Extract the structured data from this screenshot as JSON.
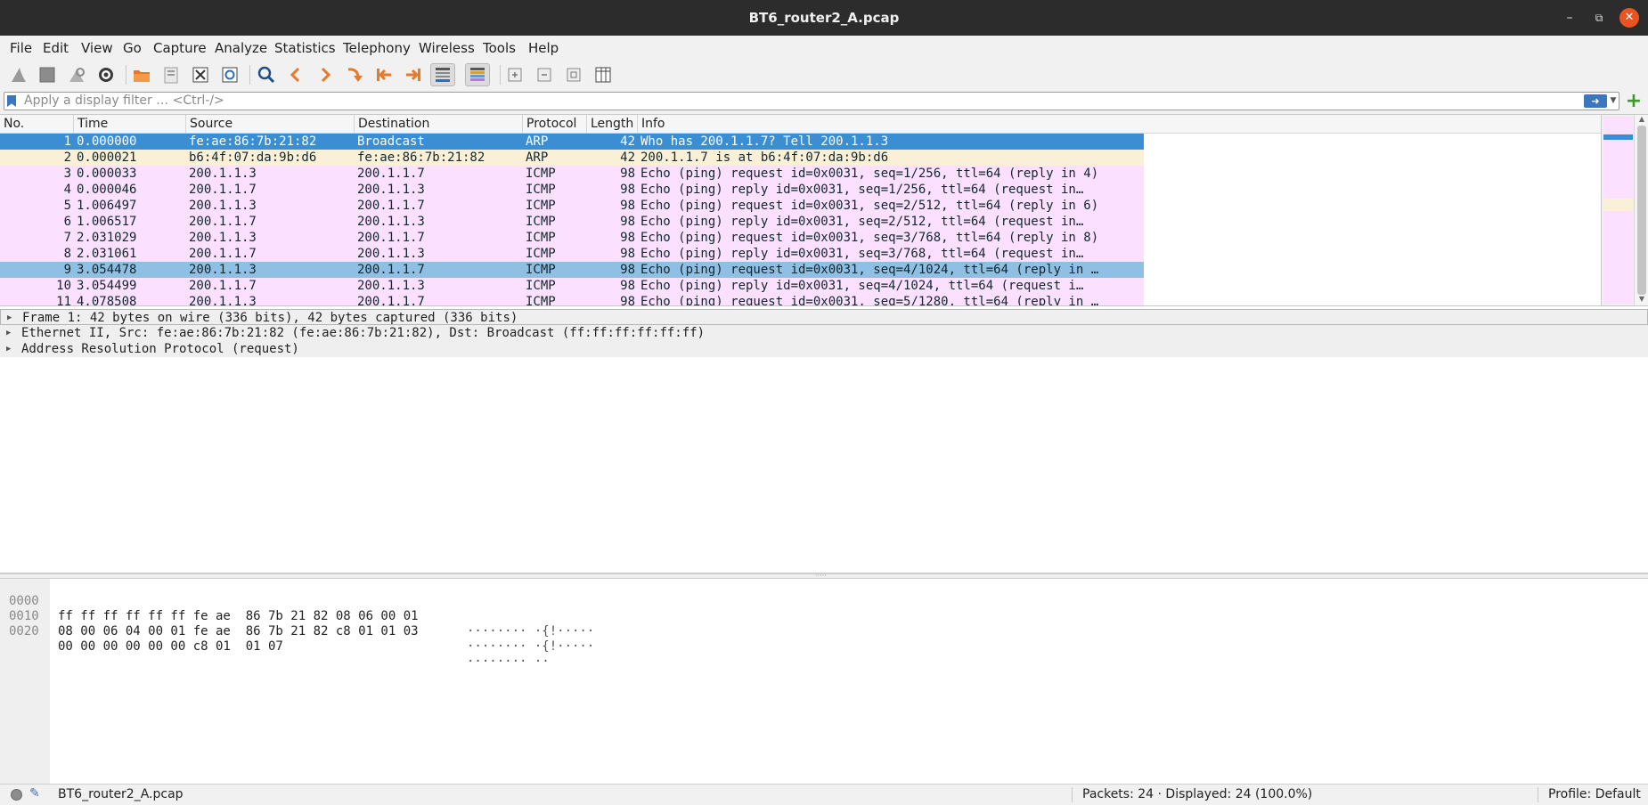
{
  "window": {
    "title": "BT6_router2_A.pcap"
  },
  "menu": [
    "File",
    "Edit",
    "View",
    "Go",
    "Capture",
    "Analyze",
    "Statistics",
    "Telephony",
    "Wireless",
    "Tools",
    "Help"
  ],
  "filter": {
    "placeholder": "Apply a display filter … <Ctrl-/>"
  },
  "packet_list": {
    "columns": [
      "No.",
      "Time",
      "Source",
      "Destination",
      "Protocol",
      "Length",
      "Info"
    ],
    "rows": [
      {
        "no": "1",
        "time": "0.000000",
        "src": "fe:ae:86:7b:21:82",
        "dst": "Broadcast",
        "proto": "ARP",
        "len": "42",
        "info": "Who has 200.1.1.7? Tell 200.1.1.3",
        "bg": "#3a8ed1",
        "selected": true
      },
      {
        "no": "2",
        "time": "0.000021",
        "src": "b6:4f:07:da:9b:d6",
        "dst": "fe:ae:86:7b:21:82",
        "proto": "ARP",
        "len": "42",
        "info": "200.1.1.7 is at b6:4f:07:da:9b:d6",
        "bg": "#faf0d7"
      },
      {
        "no": "3",
        "time": "0.000033",
        "src": "200.1.1.3",
        "dst": "200.1.1.7",
        "proto": "ICMP",
        "len": "98",
        "info": "Echo (ping) request  id=0x0031, seq=1/256, ttl=64 (reply in 4)",
        "bg": "#fce0ff"
      },
      {
        "no": "4",
        "time": "0.000046",
        "src": "200.1.1.7",
        "dst": "200.1.1.3",
        "proto": "ICMP",
        "len": "98",
        "info": "Echo (ping) reply    id=0x0031, seq=1/256, ttl=64 (request in…",
        "bg": "#fce0ff"
      },
      {
        "no": "5",
        "time": "1.006497",
        "src": "200.1.1.3",
        "dst": "200.1.1.7",
        "proto": "ICMP",
        "len": "98",
        "info": "Echo (ping) request  id=0x0031, seq=2/512, ttl=64 (reply in 6)",
        "bg": "#fce0ff"
      },
      {
        "no": "6",
        "time": "1.006517",
        "src": "200.1.1.7",
        "dst": "200.1.1.3",
        "proto": "ICMP",
        "len": "98",
        "info": "Echo (ping) reply    id=0x0031, seq=2/512, ttl=64 (request in…",
        "bg": "#fce0ff"
      },
      {
        "no": "7",
        "time": "2.031029",
        "src": "200.1.1.3",
        "dst": "200.1.1.7",
        "proto": "ICMP",
        "len": "98",
        "info": "Echo (ping) request  id=0x0031, seq=3/768, ttl=64 (reply in 8)",
        "bg": "#fce0ff"
      },
      {
        "no": "8",
        "time": "2.031061",
        "src": "200.1.1.7",
        "dst": "200.1.1.3",
        "proto": "ICMP",
        "len": "98",
        "info": "Echo (ping) reply    id=0x0031, seq=3/768, ttl=64 (request in…",
        "bg": "#fce0ff"
      },
      {
        "no": "9",
        "time": "3.054478",
        "src": "200.1.1.3",
        "dst": "200.1.1.7",
        "proto": "ICMP",
        "len": "98",
        "info": "Echo (ping) request  id=0x0031, seq=4/1024, ttl=64 (reply in …",
        "bg": "#8fbfe2"
      },
      {
        "no": "10",
        "time": "3.054499",
        "src": "200.1.1.7",
        "dst": "200.1.1.3",
        "proto": "ICMP",
        "len": "98",
        "info": "Echo (ping) reply    id=0x0031, seq=4/1024, ttl=64 (request i…",
        "bg": "#fce0ff"
      },
      {
        "no": "11",
        "time": "4.078508",
        "src": "200.1.1.3",
        "dst": "200.1.1.7",
        "proto": "ICMP",
        "len": "98",
        "info": "Echo (ping) request  id=0x0031, seq=5/1280, ttl=64 (reply in …",
        "bg": "#fce0ff"
      }
    ]
  },
  "details": [
    "Frame 1: 42 bytes on wire (336 bits), 42 bytes captured (336 bits)",
    "Ethernet II, Src: fe:ae:86:7b:21:82 (fe:ae:86:7b:21:82), Dst: Broadcast (ff:ff:ff:ff:ff:ff)",
    "Address Resolution Protocol (request)"
  ],
  "bytes": [
    {
      "offset": "0000",
      "hex": "ff ff ff ff ff ff fe ae  86 7b 21 82 08 06 00 01",
      "ascii": "········ ·{!·····"
    },
    {
      "offset": "0010",
      "hex": "08 00 06 04 00 01 fe ae  86 7b 21 82 c8 01 01 03",
      "ascii": "········ ·{!·····"
    },
    {
      "offset": "0020",
      "hex": "00 00 00 00 00 00 c8 01  01 07",
      "ascii": "········ ··"
    }
  ],
  "status": {
    "file": "BT6_router2_A.pcap",
    "packets": "Packets: 24 · Displayed: 24 (100.0%)",
    "profile": "Profile: Default"
  },
  "icons": [
    "shark-fin-start-icon",
    "stop-icon",
    "restart-icon",
    "options-gear-icon",
    "open-folder-icon",
    "save-icon",
    "close-file-icon",
    "reload-icon",
    "search-icon",
    "go-back-icon",
    "go-forward-icon",
    "go-to-packet-icon",
    "first-packet-icon",
    "last-packet-icon",
    "autoscroll-icon",
    "colorize-icon",
    "zoom-in-icon",
    "zoom-out-icon",
    "normal-size-icon",
    "resize-columns-icon"
  ]
}
